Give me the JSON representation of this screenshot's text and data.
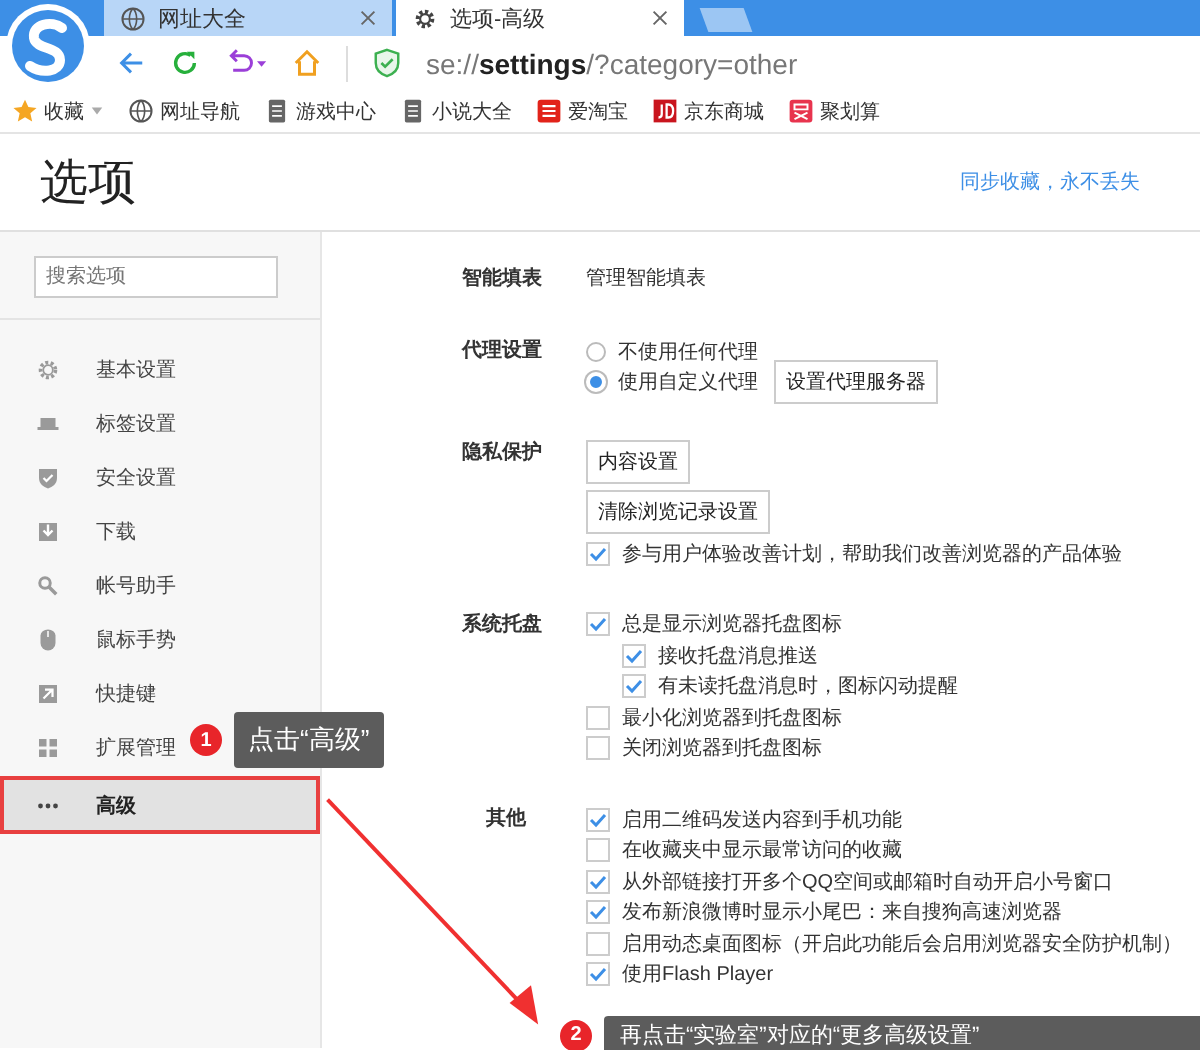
{
  "browser": {
    "tabs": [
      {
        "title": "网址大全",
        "selected": false
      },
      {
        "title": "选项-高级",
        "selected": true
      }
    ],
    "address": "se://**settings**/?category=other",
    "bookmarks": [
      {
        "label": "收藏",
        "dropdown": true
      },
      {
        "label": "网址导航",
        "dropdown": false
      },
      {
        "label": "游戏中心",
        "dropdown": false
      },
      {
        "label": "小说大全",
        "dropdown": false
      },
      {
        "label": "爱淘宝",
        "dropdown": false
      },
      {
        "label": "京东商城",
        "dropdown": false
      },
      {
        "label": "聚划算",
        "dropdown": false
      }
    ]
  },
  "page": {
    "title": "选项",
    "sync_link": "同步收藏，永不丢失"
  },
  "sidebar": {
    "search": {
      "placeholder": "搜索选项"
    },
    "items": [
      {
        "label": "基本设置",
        "selected": false
      },
      {
        "label": "标签设置",
        "selected": false
      },
      {
        "label": "安全设置",
        "selected": false
      },
      {
        "label": "下载",
        "selected": false
      },
      {
        "label": "帐号助手",
        "selected": false
      },
      {
        "label": "鼠标手势",
        "selected": false
      },
      {
        "label": "快捷键",
        "selected": false
      },
      {
        "label": "扩展管理",
        "selected": false
      },
      {
        "label": "高级",
        "selected": true
      }
    ]
  },
  "sections": [
    {
      "label": "智能填表",
      "controls": [
        {
          "kind": "text",
          "text": "管理智能填表"
        }
      ]
    },
    {
      "label": "代理设置",
      "controls": [
        {
          "kind": "radio",
          "text": "不使用任何代理",
          "selected": false
        },
        {
          "kind": "radio",
          "text": "使用自定义代理",
          "selected": true,
          "button": "设置代理服务器"
        }
      ]
    },
    {
      "label": "隐私保护",
      "controls": [
        {
          "kind": "button",
          "text": "内容设置"
        },
        {
          "kind": "button",
          "text": "清除浏览记录设置"
        },
        {
          "kind": "checkbox",
          "text": "参与用户体验改善计划，帮助我们改善浏览器的产品体验",
          "checked": true
        }
      ]
    },
    {
      "label": "系统托盘",
      "controls": [
        {
          "kind": "checkbox",
          "text": "总是显示浏览器托盘图标",
          "checked": true,
          "children": [
            {
              "kind": "checkbox",
              "text": "接收托盘消息推送",
              "checked": true
            },
            {
              "kind": "checkbox",
              "text": "有未读托盘消息时，图标闪动提醒",
              "checked": true
            }
          ]
        },
        {
          "kind": "checkbox",
          "text": "最小化浏览器到托盘图标",
          "checked": false
        },
        {
          "kind": "checkbox",
          "text": "关闭浏览器到托盘图标",
          "checked": false
        }
      ]
    },
    {
      "label": "其他",
      "controls": [
        {
          "kind": "checkbox",
          "text": "启用二维码发送内容到手机功能",
          "checked": true
        },
        {
          "kind": "checkbox",
          "text": "在收藏夹中显示最常访问的收藏",
          "checked": false
        },
        {
          "kind": "checkbox",
          "text": "从外部链接打开多个QQ空间或邮箱时自动开启小号窗口",
          "checked": true
        },
        {
          "kind": "checkbox",
          "text": "发布新浪微博时显示小尾巴：来自搜狗高速浏览器",
          "checked": true
        },
        {
          "kind": "checkbox",
          "text": "启用动态桌面图标（开启此功能后会启用浏览器安全防护机制）",
          "checked": false
        },
        {
          "kind": "checkbox",
          "text": "使用Flash Player",
          "checked": true
        }
      ]
    }
  ],
  "annotations": [
    {
      "number": "1",
      "text": "点击“高级”"
    },
    {
      "number": "2",
      "text": "再点击“实验室”对应的“更多高级设置”"
    }
  ]
}
